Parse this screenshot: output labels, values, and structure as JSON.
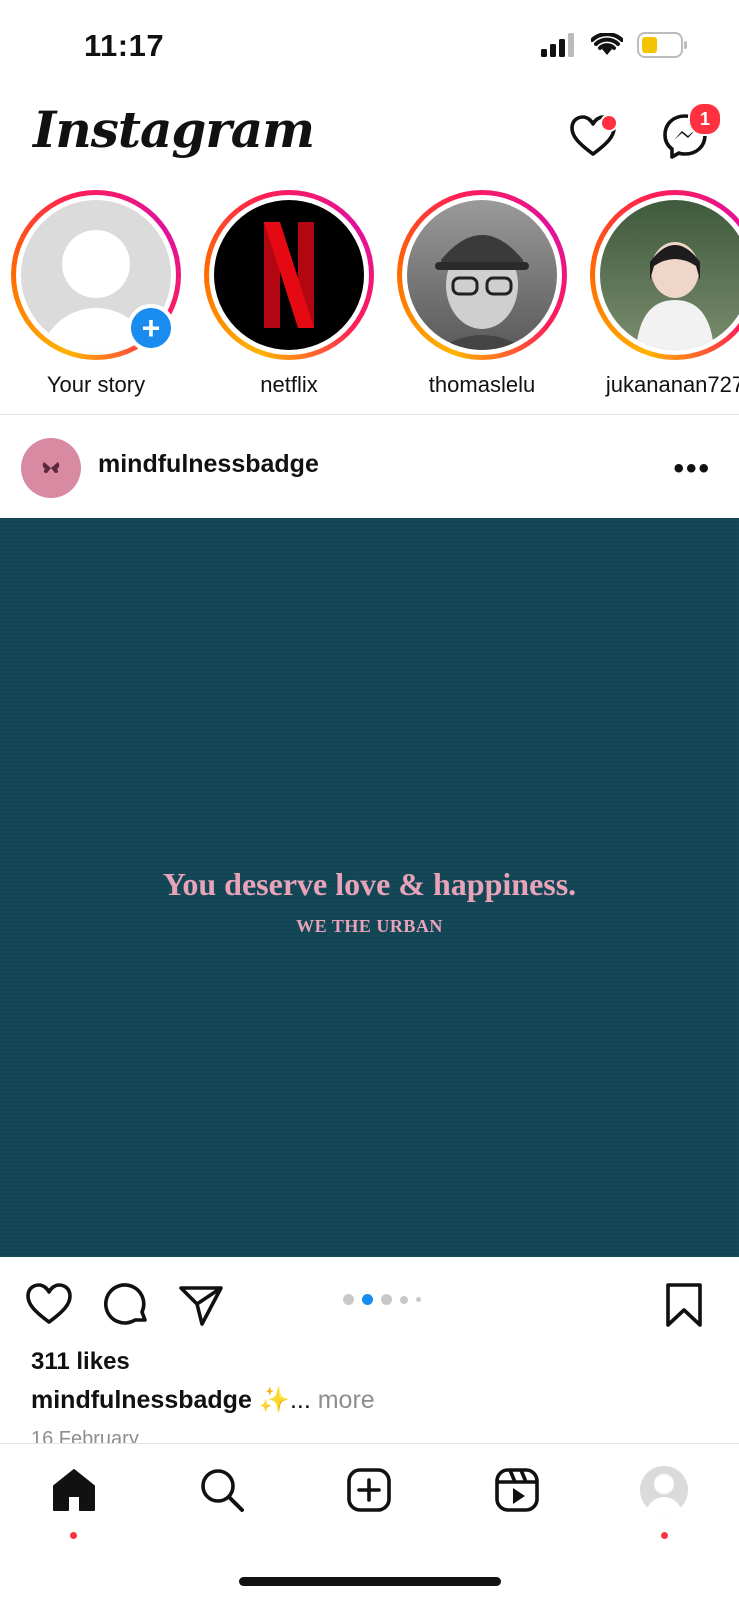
{
  "status_bar": {
    "time": "11:17",
    "battery_color": "#f5c400"
  },
  "header": {
    "logo": "Instagram",
    "messenger_badge": "1",
    "icons": [
      "heart-icon",
      "messenger-icon"
    ]
  },
  "stories": [
    {
      "label": "Your story",
      "type": "own"
    },
    {
      "label": "netflix",
      "type": "brand"
    },
    {
      "label": "thomaslelu",
      "type": "photo"
    },
    {
      "label": "jukananan727",
      "type": "photo"
    }
  ],
  "post": {
    "username": "mindfulnessbadge",
    "image_text": "You deserve love & happiness.",
    "image_brand": "WE THE URBAN",
    "image_bg": "#124655",
    "carousel": {
      "count": 5,
      "active_index": 1
    },
    "likes": "311 likes",
    "caption_user": "mindfulnessbadge",
    "caption_text": " ✨... ",
    "caption_more": "more",
    "date": "16 February"
  },
  "bottom_nav": {
    "items": [
      "home-icon",
      "search-icon",
      "create-icon",
      "reels-icon",
      "profile-icon"
    ],
    "active": "home-icon"
  },
  "colors": {
    "accent": "#ff3040",
    "blue": "#1a8cf0"
  }
}
